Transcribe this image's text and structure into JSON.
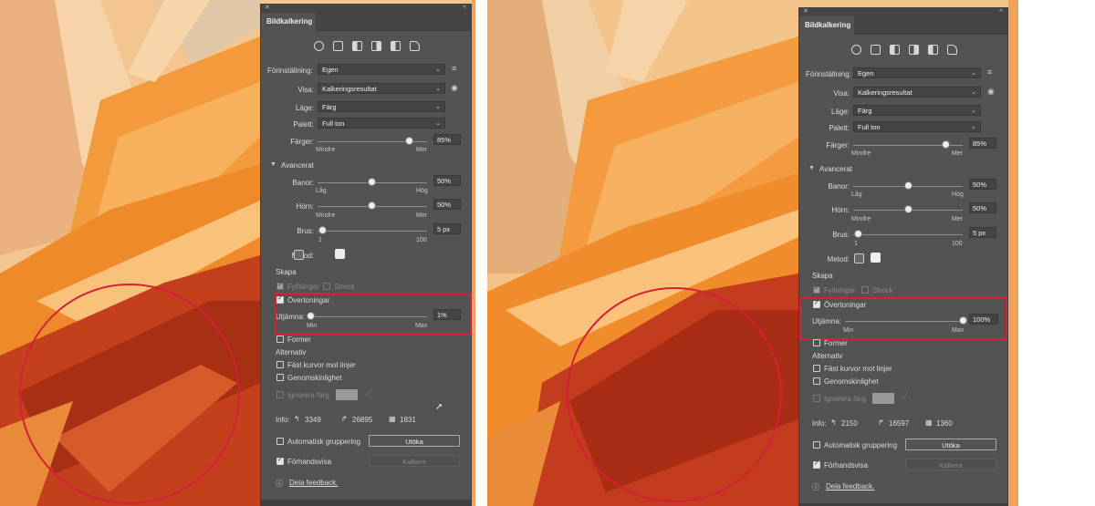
{
  "panel": {
    "title": "Bildkalkering",
    "tab_label": "Bildkalkering",
    "toolbar_icons": [
      "auto-color-icon",
      "high-color-icon",
      "low-color-icon",
      "grayscale-icon",
      "black-white-icon",
      "outline-icon"
    ],
    "preset_label": "Förinställning:",
    "preset_value": "Egen",
    "view_label": "Visa:",
    "view_value": "Kalkeringsresultat",
    "mode_label": "Läge:",
    "mode_value": "Färg",
    "palette_label": "Palett:",
    "palette_value": "Full ton",
    "colors_label": "Färger:",
    "colors_value": "85%",
    "colors_level": 0.85,
    "less_label": "Mindre",
    "more_label": "Mer",
    "advanced_label": "Avancerat",
    "paths_label": "Banor:",
    "paths_value": "50%",
    "paths_level": 0.5,
    "low_label": "Låg",
    "high_label": "Hög",
    "corners_label": "Hörn:",
    "corners_value": "50%",
    "corners_level": 0.5,
    "noise_label": "Brus:",
    "noise_value": "5 px",
    "noise_level": 0.04,
    "noise_min": "1",
    "noise_max": "100",
    "method_label": "Metod:",
    "create_label": "Skapa",
    "fills_label": "Fyllningar",
    "strokes_label": "Streck",
    "gradients_label": "Övertoningar",
    "smooth_label": "Utjämna:",
    "min_label": "Min",
    "max_label": "Max",
    "shapes_label": "Former",
    "options_label": "Alternativ",
    "snap_label": "Fäst kurvor mot linjer",
    "transparency_label": "Genomskinlighet",
    "ignore_color_label": "Ignorera färg",
    "info_label": "Info:",
    "auto_group_label": "Automatisk gruppering",
    "expand_button": "Utöka",
    "preview_label": "Förhandsvisa",
    "trace_button": "Kalkera",
    "feedback_label": "Dela feedback."
  },
  "left": {
    "smooth_value": "1%",
    "smooth_level": 0.0,
    "info_anchors": "3349",
    "info_paths": "26895",
    "info_colors": "1831"
  },
  "right": {
    "smooth_value": "100%",
    "smooth_level": 1.0,
    "info_anchors": "2150",
    "info_paths": "16597",
    "info_colors": "1360"
  },
  "colors": {
    "panel_bg": "#535353",
    "highlight": "#d5203a",
    "art_orange": "#f08a2c",
    "art_red": "#b8341a",
    "art_cream": "#f2c48a"
  }
}
